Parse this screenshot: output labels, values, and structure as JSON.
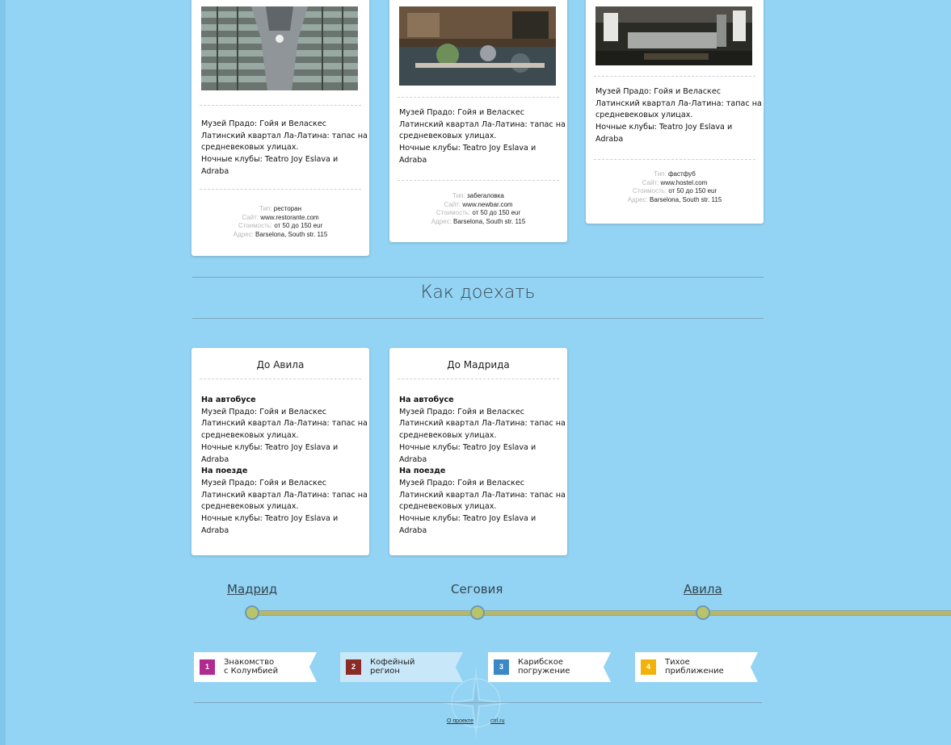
{
  "places": [
    {
      "desc": [
        "Музей Прадо: Гойя и Веласкес",
        "Латинский квартал Ла-Латина: тапас на",
        "средневековых улицах.",
        "Ночные клубы: Teatro Joy Eslava  и",
        "Adraba"
      ],
      "meta": [
        {
          "k": "Тип:",
          "v": "ресторан"
        },
        {
          "k": "Сайт:",
          "v": "www.restorante.com"
        },
        {
          "k": "Стоимость:",
          "v": "от 50 до 150 eur"
        },
        {
          "k": "Адрес:",
          "v": "Barselona, South str. 115"
        }
      ]
    },
    {
      "desc": [
        "Музей Прадо: Гойя и Веласкес",
        "Латинский квартал Ла-Латина: тапас на",
        "средневековых улицах.",
        "Ночные клубы: Teatro Joy Eslava  и",
        "Adraba"
      ],
      "meta": [
        {
          "k": "Тип:",
          "v": "забегаловка"
        },
        {
          "k": "Сайт:",
          "v": "www.newbar.com"
        },
        {
          "k": "Стоимость:",
          "v": "от 50 до 150 eur"
        },
        {
          "k": "Адрес:",
          "v": "Barselona, South str. 115"
        }
      ]
    },
    {
      "desc": [
        "Музей Прадо: Гойя и Веласкес",
        "Латинский квартал Ла-Латина: тапас на",
        "средневековых улицах.",
        "Ночные клубы: Teatro Joy Eslava  и",
        "Adraba"
      ],
      "meta": [
        {
          "k": "Тип:",
          "v": "фастфуб"
        },
        {
          "k": "Сайт:",
          "v": "www.hostel.com"
        },
        {
          "k": "Стоимость:",
          "v": "от 50 до 150 eur"
        },
        {
          "k": "Адрес:",
          "v": "Barselona, South str. 115"
        }
      ]
    }
  ],
  "section_title": "Как доехать",
  "routes": [
    {
      "title": "До Авила",
      "bus_heading": "На автобусе",
      "bus": [
        "Музей Прадо: Гойя и Веласкес",
        "Латинский квартал Ла-Латина: тапас на",
        "средневековых улицах.",
        "Ночные клубы: Teatro Joy Eslava  и",
        "Adraba"
      ],
      "train_heading": "На поезде",
      "train": [
        "Музей Прадо: Гойя и Веласкес",
        "Латинский квартал Ла-Латина: тапас на",
        "средневековых улицах.",
        "Ночные клубы: Teatro Joy Eslava  и",
        "Adraba"
      ]
    },
    {
      "title": "До Мадрида",
      "bus_heading": "На автобусе",
      "bus": [
        "Музей Прадо: Гойя и Веласкес",
        "Латинский квартал Ла-Латина: тапас на",
        "средневековых улицах.",
        "Ночные клубы: Teatro Joy Eslava  и",
        "Adraba"
      ],
      "train_heading": "На поезде",
      "train": [
        "Музей Прадо: Гойя и Веласкес",
        "Латинский квартал Ла-Латина: тапас на",
        "средневековых улицах.",
        "Ночные клубы: Teatro Joy Eslava  и",
        "Adraba"
      ]
    }
  ],
  "timeline": {
    "cities": [
      "Мадрид",
      "Сеговия",
      "Авила"
    ]
  },
  "tabs": [
    {
      "num": "1",
      "line1": "Знакомство",
      "line2": "с Колумбией",
      "color": "#b12a8f"
    },
    {
      "num": "2",
      "line1": "Кофейный",
      "line2": "регион",
      "color": "#8b2b28"
    },
    {
      "num": "3",
      "line1": "Карибское",
      "line2": "погружение",
      "color": "#3a88c6"
    },
    {
      "num": "4",
      "line1": "Тихое",
      "line2": "приближение",
      "color": "#f2b20a"
    }
  ],
  "footer": {
    "about": "О проекте",
    "credit": "ctrl.ru"
  }
}
